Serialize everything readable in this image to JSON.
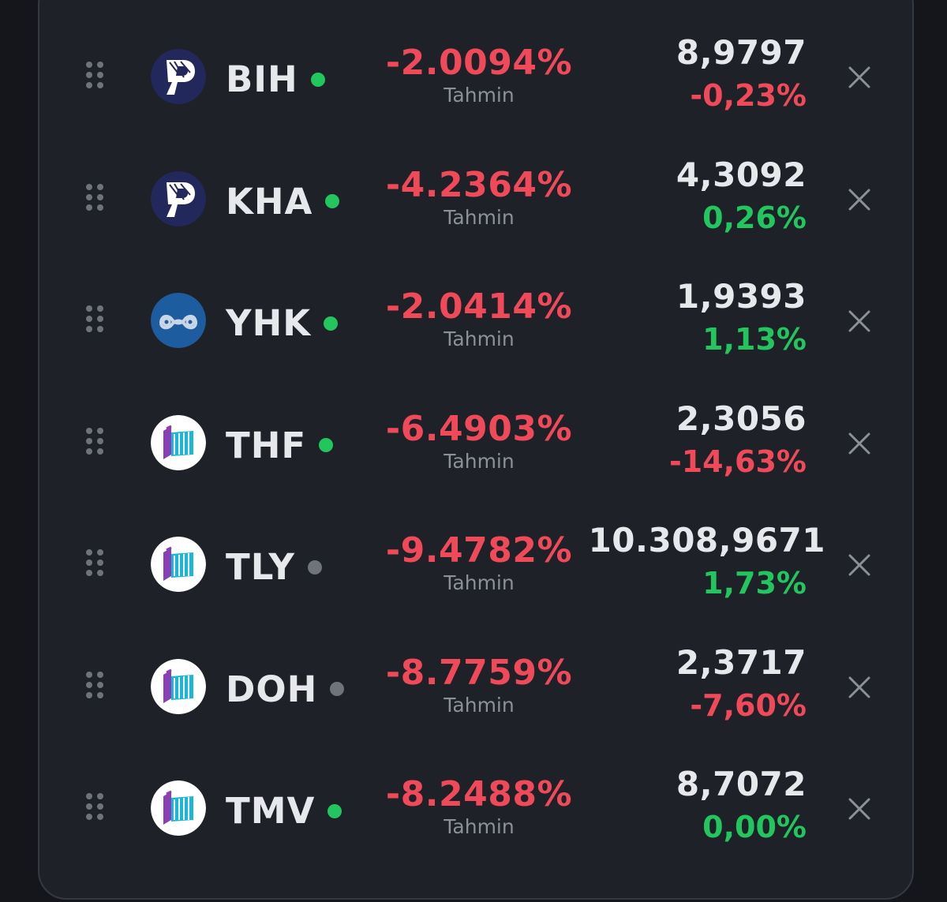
{
  "colors": {
    "negative": "#f04a5a",
    "positive": "#22c55e",
    "status_open": "#22c55e",
    "status_closed": "#6e737c"
  },
  "rows": [
    {
      "ticker": "BIH",
      "logo": "p-logo-icon",
      "status": "open",
      "estimate": "-2.0094%",
      "estimate_label": "Tahmin",
      "price": "8,9797",
      "change": "-0,23%",
      "change_dir": "negative"
    },
    {
      "ticker": "KHA",
      "logo": "p-logo-icon",
      "status": "open",
      "estimate": "-4.2364%",
      "estimate_label": "Tahmin",
      "price": "4,3092",
      "change": "0,26%",
      "change_dir": "positive"
    },
    {
      "ticker": "YHK",
      "logo": "wave-logo-icon",
      "status": "open",
      "estimate": "-2.0414%",
      "estimate_label": "Tahmin",
      "price": "1,9393",
      "change": "1,13%",
      "change_dir": "positive"
    },
    {
      "ticker": "THF",
      "logo": "cube-logo-icon",
      "status": "open",
      "estimate": "-6.4903%",
      "estimate_label": "Tahmin",
      "price": "2,3056",
      "change": "-14,63%",
      "change_dir": "negative"
    },
    {
      "ticker": "TLY",
      "logo": "cube-logo-icon",
      "status": "closed",
      "estimate": "-9.4782%",
      "estimate_label": "Tahmin",
      "price": "10.308,9671",
      "change": "1,73%",
      "change_dir": "positive"
    },
    {
      "ticker": "DOH",
      "logo": "cube-logo-icon",
      "status": "closed",
      "estimate": "-8.7759%",
      "estimate_label": "Tahmin",
      "price": "2,3717",
      "change": "-7,60%",
      "change_dir": "negative"
    },
    {
      "ticker": "TMV",
      "logo": "cube-logo-icon",
      "status": "open",
      "estimate": "-8.2488%",
      "estimate_label": "Tahmin",
      "price": "8,7072",
      "change": "0,00%",
      "change_dir": "positive"
    }
  ]
}
